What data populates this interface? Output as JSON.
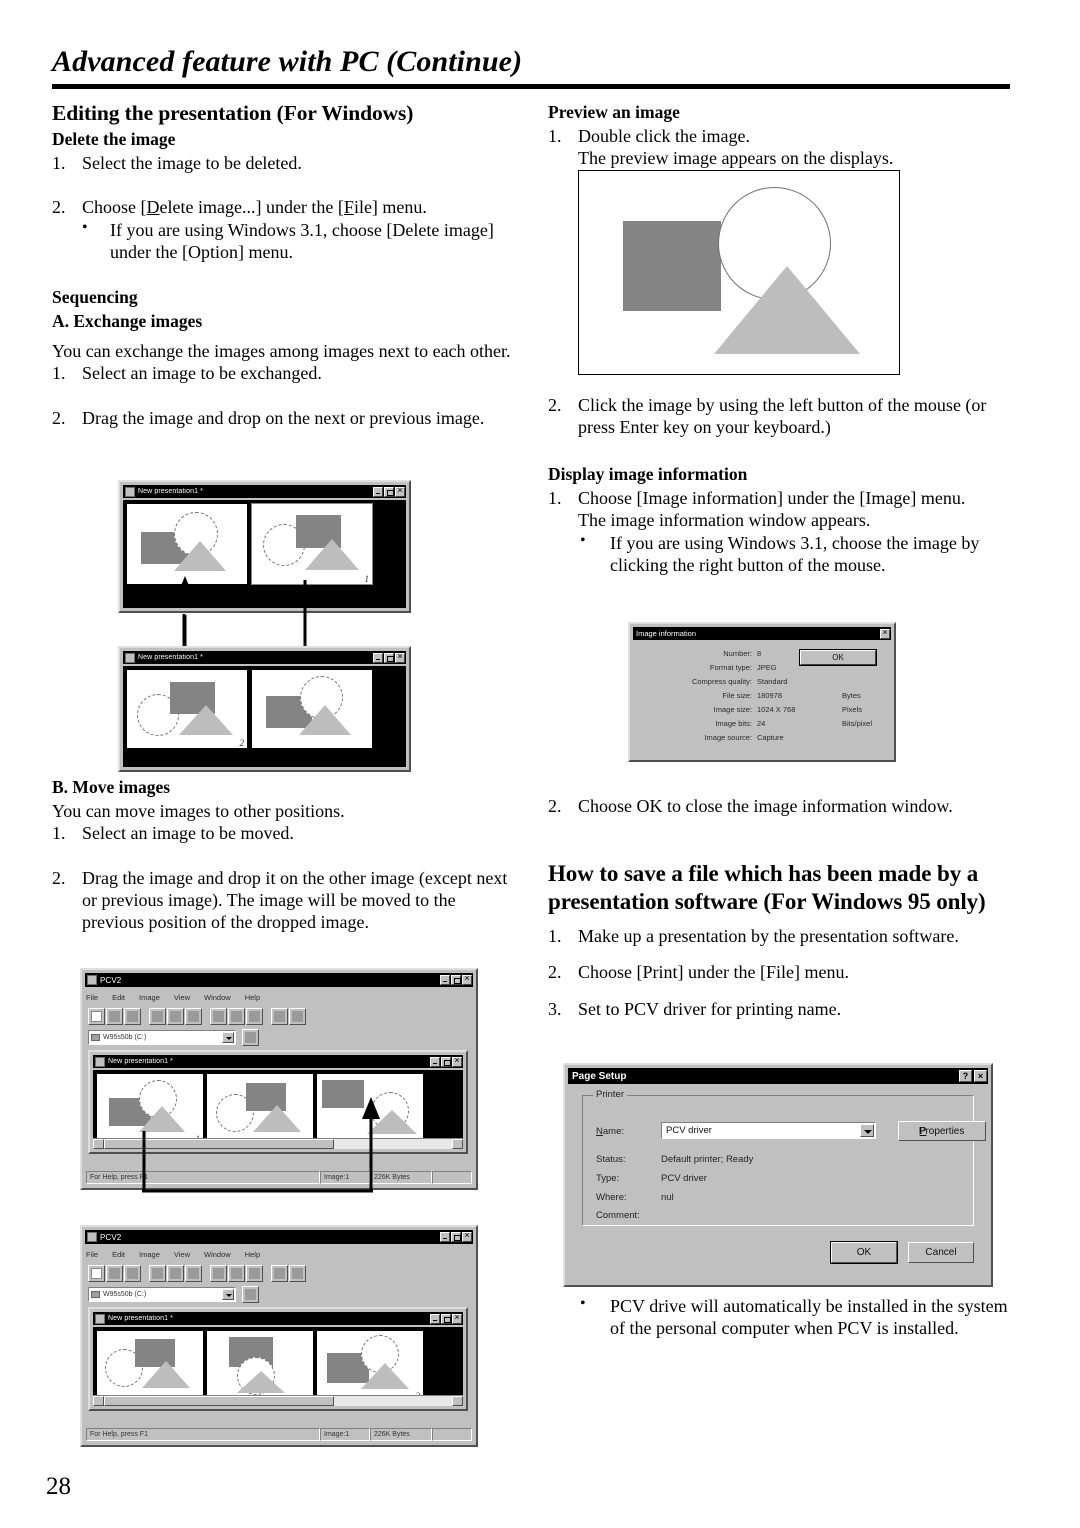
{
  "header": {
    "title": "Advanced feature with PC (Continue)"
  },
  "page_number": "28",
  "left": {
    "section_title": "Editing the presentation (For Windows)",
    "delete": {
      "heading": "Delete the image",
      "step1_num": "1.",
      "step1": "Select the image to be deleted.",
      "step2_num": "2.",
      "step2_pre": "Choose [",
      "step2_u1": "D",
      "step2_mid": "elete image...] under the [",
      "step2_u2": "F",
      "step2_post": "ile] menu.",
      "bullet": "If you are using Windows 3.1, choose [Delete image] under the [Option] menu."
    },
    "sequencing": {
      "heading": "Sequencing",
      "sub_a": "A. Exchange images",
      "intro": "You can exchange the images among images next to each other.",
      "step1_num": "1.",
      "step1": "Select an image to be exchanged.",
      "step2_num": "2.",
      "step2": "Drag the image and drop on the next or previous image."
    },
    "move": {
      "sub_b": "B. Move images",
      "intro": "You can move images to other positions.",
      "step1_num": "1.",
      "step1": "Select an image to be moved.",
      "step2_num": "2.",
      "step2": "Drag the image and drop it on the other image (except next or previous image). The image will be moved to the previous position of the dropped image."
    },
    "exchange_fig": {
      "window_title": "New presentation1 *",
      "slide_numbers": [
        "",
        "1"
      ]
    },
    "exchange_fig2": {
      "window_title": "New presentation1 *",
      "slide_numbers": [
        "",
        "2"
      ]
    }
  },
  "right": {
    "preview": {
      "heading": "Preview an image",
      "step1_num": "1.",
      "step1": "Double click the image.",
      "step1_note": "The preview image appears on the displays.",
      "step2_num": "2.",
      "step2": "Click the image by using the left button of the mouse (or press Enter key on your keyboard.)"
    },
    "display_info": {
      "heading": "Display image information",
      "step1_num": "1.",
      "step1": "Choose [Image information] under the [Image] menu.",
      "step1_note": "The image information window appears.",
      "bullet": "If you are using Windows 3.1, choose the image by clicking the right button of the mouse.",
      "step2_num": "2.",
      "step2": "Choose OK to close the image information window."
    },
    "howto": {
      "heading": "How to save a file which has been made by a presentation software (For Windows 95 only)",
      "step1_num": "1.",
      "step1": "Make up a presentation by the presentation software.",
      "step2_num": "2.",
      "step2": "Choose [Print] under the [File] menu.",
      "step3_num": "3.",
      "step3": "Set to PCV driver for printing name.",
      "bullet": "PCV drive will automatically be installed in the system of the personal computer when PCV is installed."
    }
  },
  "image_info_dialog": {
    "title": "Image information",
    "ok_label": "OK",
    "rows": [
      {
        "label": "Number:",
        "value": "8",
        "unit": ""
      },
      {
        "label": "Format type:",
        "value": "JPEG",
        "unit": ""
      },
      {
        "label": "Compress quality:",
        "value": "Standard",
        "unit": ""
      },
      {
        "label": "File size:",
        "value": "180978",
        "unit": "Bytes"
      },
      {
        "label": "Image size:",
        "value": "1024  X  768",
        "unit": "Pixels"
      },
      {
        "label": "Image bits:",
        "value": "24",
        "unit": "Bits/pixel"
      },
      {
        "label": "Image source:",
        "value": "Capture",
        "unit": ""
      }
    ]
  },
  "page_setup_dialog": {
    "title": "Page Setup",
    "help_btn": "?",
    "close_btn": "×",
    "group_label": "Printer",
    "name_label": "Name:",
    "name_value": "PCV driver",
    "properties_label": "Properties",
    "status_label": "Status:",
    "status_value": "Default printer; Ready",
    "type_label": "Type:",
    "type_value": "PCV driver",
    "where_label": "Where:",
    "where_value": "nul",
    "comment_label": "Comment:",
    "comment_value": "",
    "ok_label": "OK",
    "cancel_label": "Cancel"
  },
  "pcv_window": {
    "title": "PCV2",
    "menus": [
      "File",
      "Edit",
      "Image",
      "View",
      "Window",
      "Help"
    ],
    "drive_combo": "W95s50b (C:)",
    "inner_title": "New presentation1 *",
    "status_help": "For Help, press F1",
    "status_images": "Image:1",
    "status_bytes": "226K Bytes",
    "slide_numbers_first": [
      "1",
      "",
      ""
    ],
    "slide_numbers_second": [
      "",
      "",
      "2"
    ]
  }
}
